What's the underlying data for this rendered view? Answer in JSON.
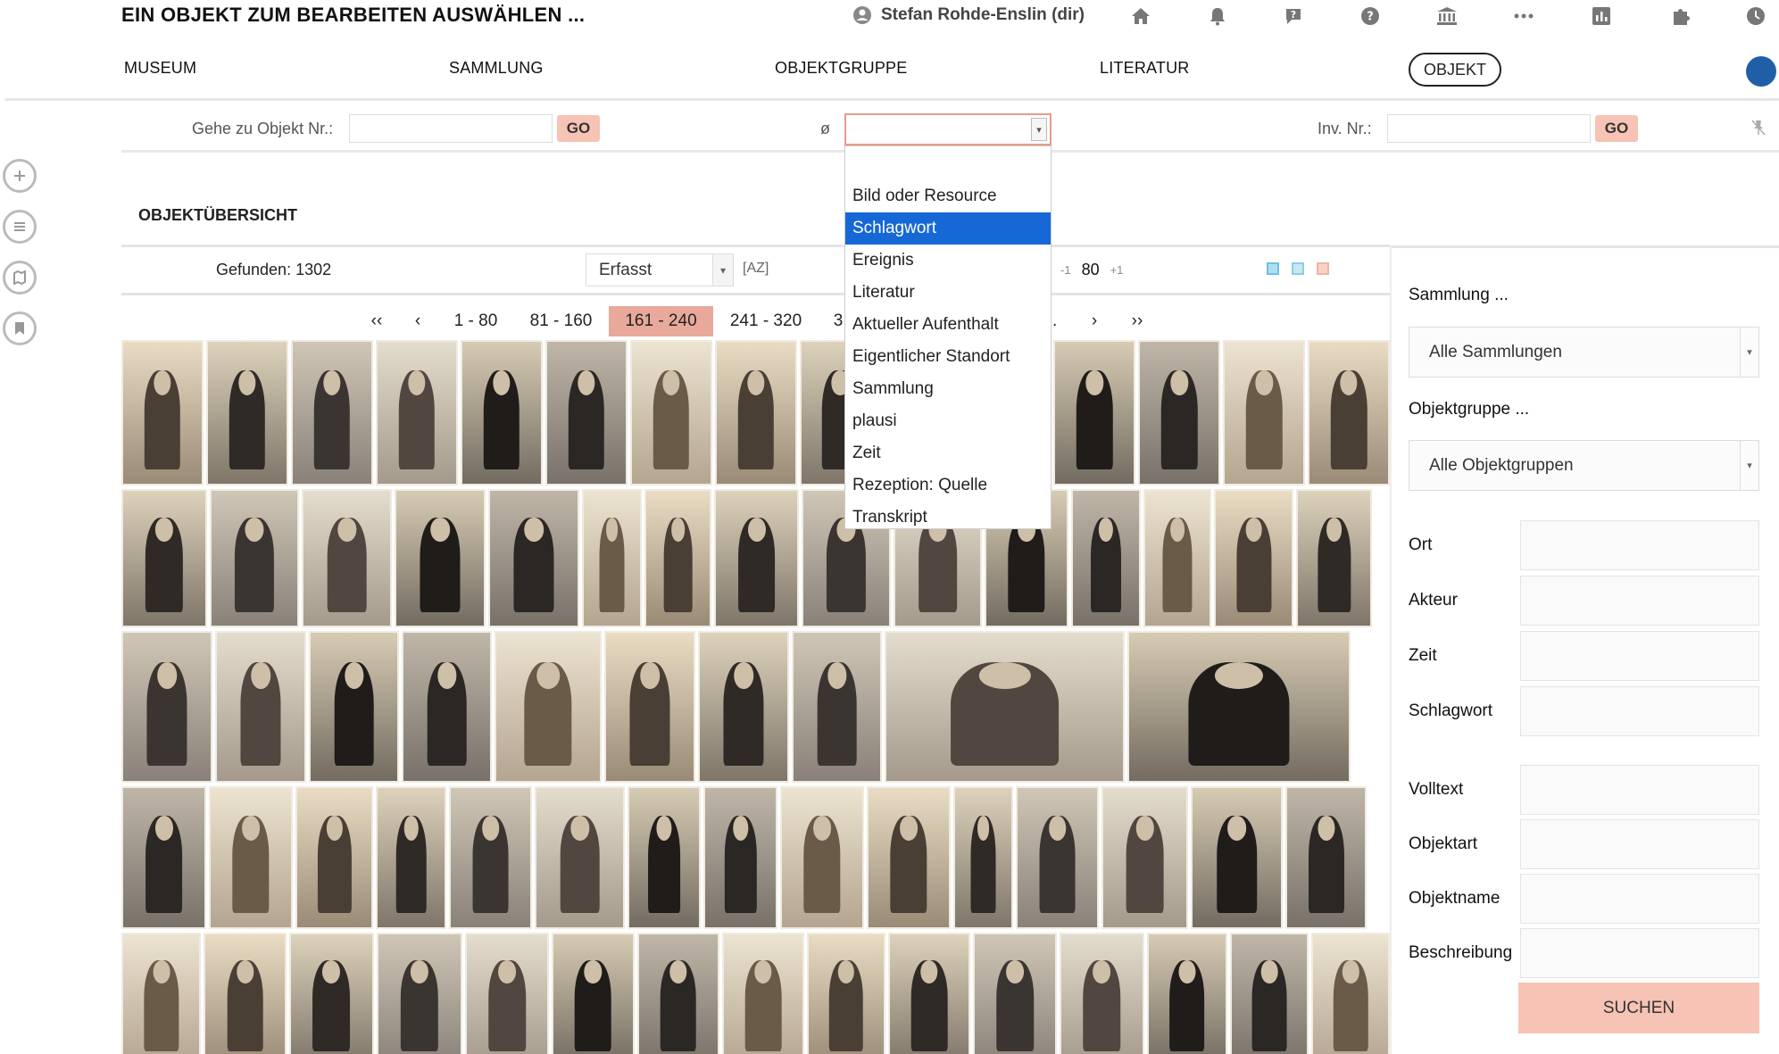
{
  "header": {
    "title": "EIN OBJEKT ZUM BEARBEITEN AUSWÄHLEN ...",
    "user": "Stefan Rohde-Enslin (dir)"
  },
  "nav": {
    "items": [
      "MUSEUM",
      "SAMMLUNG",
      "OBJEKTGRUPPE",
      "LITERATUR"
    ],
    "active": "OBJEKT"
  },
  "search": {
    "goto_label": "Gehe zu Objekt Nr.:",
    "go_label": "GO",
    "empty_symbol": "ø",
    "inv_label": "Inv. Nr.:",
    "go2_label": "GO",
    "goto_value": "",
    "inv_value": ""
  },
  "dropdown": {
    "options": [
      "",
      "Bild oder Resource",
      "Schlagwort",
      "Ereignis",
      "Literatur",
      "Aktueller Aufenthalt",
      "Eigentlicher Standort",
      "Sammlung",
      "plausi",
      "Zeit",
      "Rezeption: Quelle",
      "Transkript"
    ],
    "selected_index": 2
  },
  "overview": {
    "title": "OBJEKTÜBERSICHT",
    "found": "Gefunden: 1302",
    "sort_value": "Erfasst",
    "az": "[AZ]",
    "zoom_minus": "-1",
    "zoom_value": "80",
    "zoom_plus": "+1"
  },
  "pagination": {
    "first": "‹‹",
    "prev": "‹",
    "pages": [
      "1 - 80",
      "81 - 160",
      "161 - 240",
      "241 - 320",
      "3"
    ],
    "ellipsis": "..",
    "next": "›",
    "last": "››",
    "active_index": 2
  },
  "filters": {
    "sammlung_label": "Sammlung ...",
    "sammlung_value": "Alle Sammlungen",
    "objektgruppe_label": "Objektgruppe ...",
    "objektgruppe_value": "Alle Objektgruppen",
    "fields": [
      "Ort",
      "Akteur",
      "Zeit",
      "Schlagwort",
      "Volltext",
      "Objektart",
      "Objektname",
      "Beschreibung"
    ],
    "search_button": "SUCHEN"
  },
  "colors": {
    "accent": "#f7c3b5",
    "active_page": "#e8a99a",
    "selected_option": "#1668d6",
    "nav_dot": "#1e5fa8"
  }
}
